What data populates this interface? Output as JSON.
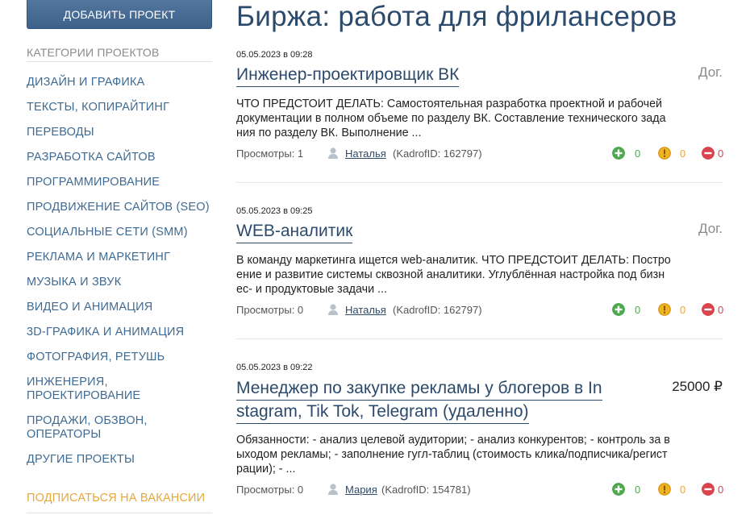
{
  "sidebar": {
    "add_button": "ДОБАВИТЬ ПРОЕКТ",
    "categories_title": "КАТЕГОРИИ ПРОЕКТОВ",
    "categories": [
      "ДИЗАЙН И ГРАФИКА",
      "ТЕКСТЫ, КОПИРАЙТИНГ",
      "ПЕРЕВОДЫ",
      "РАЗРАБОТКА САЙТОВ",
      "ПРОГРАММИРОВАНИЕ",
      "ПРОДВИЖЕНИЕ САЙТОВ (SEO)",
      "СОЦИАЛЬНЫЕ СЕТИ (SMM)",
      "РЕКЛАМА И МАРКЕТИНГ",
      "МУЗЫКА И ЗВУК",
      "ВИДЕО И АНИМАЦИЯ",
      "3D-ГРАФИКА И АНИМАЦИЯ",
      "ФОТОГРАФИЯ, РЕТУШЬ",
      "ИНЖЕНЕРИЯ, ПРОЕКТИРОВАНИЕ",
      "ПРОДАЖИ, ОБЗВОН, ОПЕРАТОРЫ",
      "ДРУГИЕ ПРОЕКТЫ"
    ],
    "subscribe": "ПОДПИСАТЬСЯ НА ВАКАНСИИ"
  },
  "page_title": "Биржа: работа для фрилансеров",
  "projects": [
    {
      "date": "05.05.2023 в 09:28",
      "title_lines": [
        "Инженер-проектировщик ВК"
      ],
      "price": "Дог.",
      "desc_lines": [
        "ЧТО ПРЕДСТОИТ ДЕЛАТЬ: Самостоятельная разработка проектной и рабочей",
        "документации в полном объеме по разделу ВК. Составление технического зада",
        "ния по разделу ВК. Выполнение ..."
      ],
      "views": "Просмотры: 1",
      "user": "Наталья",
      "kadrof_id": "(KadrofID: 162797)",
      "votes": {
        "plus": "0",
        "neutral": "0",
        "minus": "0"
      }
    },
    {
      "date": "05.05.2023 в 09:25",
      "title_lines": [
        "WEB-аналитик"
      ],
      "price": "Дог.",
      "desc_lines": [
        "В команду маркетинга ищется web-аналитик. ЧТО ПРЕДСТОИТ ДЕЛАТЬ: Постро",
        "ение и развитие системы сквозной аналитики. Углублённая настройка под бизн",
        "ес- и продуктовые задачи ..."
      ],
      "views": "Просмотры: 0",
      "user": "Наталья",
      "kadrof_id": "(KadrofID: 162797)",
      "votes": {
        "plus": "0",
        "neutral": "0",
        "minus": "0"
      }
    },
    {
      "date": "05.05.2023 в 09:22",
      "title_lines": [
        "Менеджер по закупке рекламы у блогеров в In",
        "stagram, Tik Tok, Telegram (удаленно)"
      ],
      "price": "25000 ₽",
      "desc_lines": [
        "Обязанности: - анализ целевой аудитории; - анализ конкурентов; - контроль за в",
        "ыходом рекламы; - заполнение гугл-таблиц (стоимость клика/подписчика/регист",
        "рации); - ..."
      ],
      "views": "Просмотры: 0",
      "user": "Мария",
      "kadrof_id": "(KadrofID: 154781)",
      "votes": {
        "plus": "0",
        "neutral": "0",
        "minus": "0"
      }
    }
  ],
  "colors": {
    "brand": "#3f6a92",
    "title": "#2c4a6b",
    "subscribe": "#e6a73b",
    "vote_plus": "#4ea84e",
    "vote_neutral": "#f0b323",
    "vote_minus": "#d9434b"
  }
}
